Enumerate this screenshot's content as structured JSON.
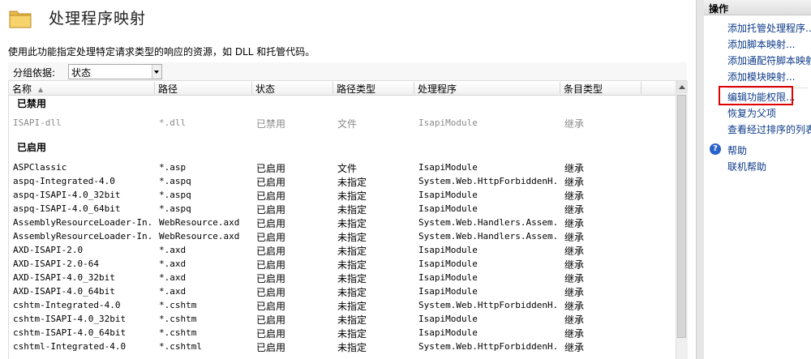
{
  "page": {
    "title": "处理程序映射",
    "description": "使用此功能指定处理特定请求类型的响应的资源，如 DLL 和托管代码。"
  },
  "group_by": {
    "label": "分组依据:",
    "value": "状态"
  },
  "table": {
    "columns": [
      "名称",
      "路径",
      "状态",
      "路径类型",
      "处理程序",
      "条目类型"
    ],
    "groups": [
      {
        "name": "已禁用",
        "rows": [
          [
            "ISAPI-dll",
            "*.dll",
            "已禁用",
            "文件",
            "IsapiModule",
            "继承"
          ]
        ]
      },
      {
        "name": "已启用",
        "rows": [
          [
            "ASPClassic",
            "*.asp",
            "已启用",
            "文件",
            "IsapiModule",
            "继承"
          ],
          [
            "aspq-Integrated-4.0",
            "*.aspq",
            "已启用",
            "未指定",
            "System.Web.HttpForbiddenH...",
            "继承"
          ],
          [
            "aspq-ISAPI-4.0_32bit",
            "*.aspq",
            "已启用",
            "未指定",
            "IsapiModule",
            "继承"
          ],
          [
            "aspq-ISAPI-4.0_64bit",
            "*.aspq",
            "已启用",
            "未指定",
            "IsapiModule",
            "继承"
          ],
          [
            "AssemblyResourceLoader-In...",
            "WebResource.axd",
            "已启用",
            "未指定",
            "System.Web.Handlers.Assem...",
            "继承"
          ],
          [
            "AssemblyResourceLoader-In...",
            "WebResource.axd",
            "已启用",
            "未指定",
            "System.Web.Handlers.Assem...",
            "继承"
          ],
          [
            "AXD-ISAPI-2.0",
            "*.axd",
            "已启用",
            "未指定",
            "IsapiModule",
            "继承"
          ],
          [
            "AXD-ISAPI-2.0-64",
            "*.axd",
            "已启用",
            "未指定",
            "IsapiModule",
            "继承"
          ],
          [
            "AXD-ISAPI-4.0_32bit",
            "*.axd",
            "已启用",
            "未指定",
            "IsapiModule",
            "继承"
          ],
          [
            "AXD-ISAPI-4.0_64bit",
            "*.axd",
            "已启用",
            "未指定",
            "IsapiModule",
            "继承"
          ],
          [
            "cshtm-Integrated-4.0",
            "*.cshtm",
            "已启用",
            "未指定",
            "System.Web.HttpForbiddenH...",
            "继承"
          ],
          [
            "cshtm-ISAPI-4.0_32bit",
            "*.cshtm",
            "已启用",
            "未指定",
            "IsapiModule",
            "继承"
          ],
          [
            "cshtm-ISAPI-4.0_64bit",
            "*.cshtm",
            "已启用",
            "未指定",
            "IsapiModule",
            "继承"
          ],
          [
            "cshtml-Integrated-4.0",
            "*.cshtml",
            "已启用",
            "未指定",
            "System.Web.HttpForbiddenH...",
            "继承"
          ]
        ]
      }
    ]
  },
  "actions": {
    "header": "操作",
    "items": [
      "添加托管处理程序...",
      "添加脚本映射...",
      "添加通配符脚本映射...",
      "添加模块映射...",
      "编辑功能权限...",
      "恢复为父项",
      "查看经过排序的列表..."
    ],
    "help": [
      "帮助",
      "联机帮助"
    ]
  },
  "colors": {
    "link": "#0d3a8a",
    "highlight": "#e00000"
  },
  "icons": [
    "folder-icon",
    "sort-ascending-icon",
    "dropdown-arrow-icon",
    "help-icon"
  ]
}
